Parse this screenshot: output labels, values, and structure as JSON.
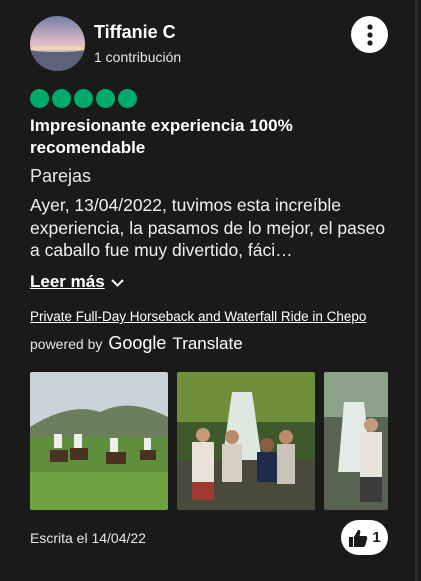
{
  "review": {
    "author": "Tiffanie C",
    "contributions": "1 contribución",
    "rating_bubbles": 5,
    "title": "Impresionante experiencia 100% recomendable",
    "trip_type": "Parejas",
    "text": "Ayer, 13/04/2022, tuvimos esta increíble experiencia, la pasamos de lo mejor, el paseo a caballo fue muy divertido, fáci…",
    "read_more": "Leer más",
    "product_link": "Private Full-Day Horseback and Waterfall Ride in Chepo",
    "powered_by": "powered by",
    "google": "Google",
    "translate": "Translate",
    "written_date": "Escrita el 14/04/22",
    "helpful_count": "1"
  },
  "colors": {
    "background": "#1a1a1a",
    "rating_green": "#00aa6c",
    "text": "#ffffff"
  },
  "icons": [
    "more-vertical-icon",
    "chevron-down-icon",
    "thumbs-up-icon"
  ]
}
